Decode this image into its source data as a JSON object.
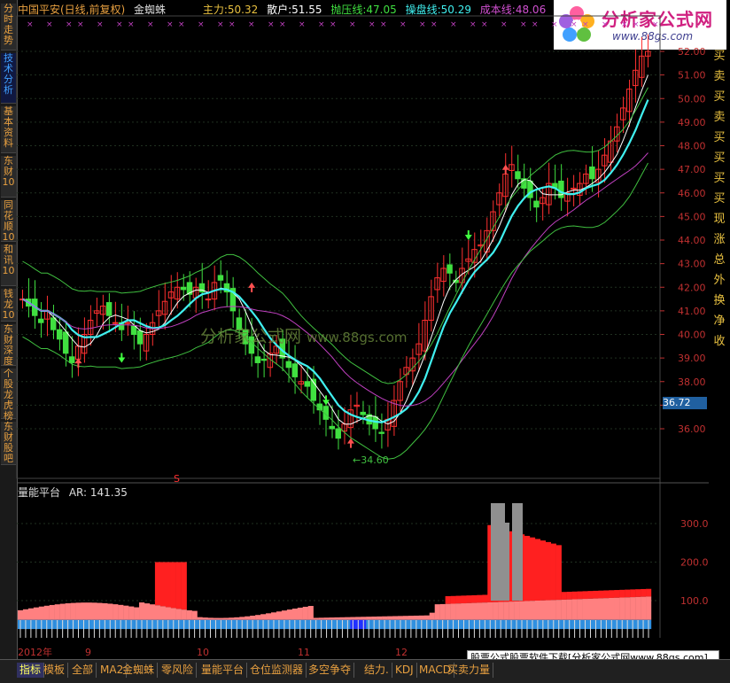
{
  "top_info": {
    "stock": "中国平安(日线,前复权)",
    "indicator": "金蜘蛛",
    "zl_label": "主力:",
    "zl_val": "50.32",
    "sh_label": "散户:",
    "sh_val": "51.55",
    "pyx_label": "抛压线:",
    "pyx_val": "47.05",
    "cpx_label": "操盘线:",
    "cpx_val": "50.29",
    "cbx_label": "成本线:",
    "cbx_val": "48.06"
  },
  "logo": {
    "title": "分析家公式网",
    "url": "www.88gs.com"
  },
  "watermark": {
    "text": "分析家公式网",
    "url": "www.88gs.com"
  },
  "left_tabs": [
    "分时走势",
    "技术分析",
    "基本资料",
    "东财10",
    "同花顺10",
    "和讯10",
    "钱龙10",
    "东财深度",
    "个股龙虎榜",
    "东财股吧"
  ],
  "right_labels": [
    "买",
    "卖",
    "买",
    "卖",
    "买",
    "买",
    "买",
    "买",
    "现",
    "涨",
    "总",
    "外",
    "换",
    "净",
    "收"
  ],
  "price_axis": [
    "52.00",
    "51.00",
    "50.00",
    "49.00",
    "48.00",
    "47.00",
    "46.00",
    "45.00",
    "44.00",
    "43.00",
    "42.00",
    "41.00",
    "40.00",
    "39.00",
    "38.00",
    "37.00",
    "36.00"
  ],
  "current_price": "36.72",
  "low_label": "←34.60",
  "s_marker": "S",
  "indicator_panel": {
    "name": "量能平台",
    "ar_label": "AR:",
    "ar_val": "141.35",
    "axis": [
      "300.0",
      "200.0",
      "100.0"
    ]
  },
  "date_axis": [
    "2012年",
    "9",
    "10",
    "11",
    "12"
  ],
  "bottom_tabs": [
    "指标",
    "模板",
    "全部",
    "MA2",
    "金蜘蛛",
    "零风险",
    "量能平台",
    "仓位监测器",
    "多空争夺",
    "结力.",
    "KDJ",
    "MACD",
    "买卖力量"
  ],
  "status_text": "股票公式股票软件下载[分析家公式网www.88gs.com]",
  "colors": {
    "up": "#ff3030",
    "down": "#40e040",
    "cyan": "#40f0f0",
    "magenta": "#c040c0",
    "pink": "#ff8080",
    "blue": "#3090e0"
  }
}
